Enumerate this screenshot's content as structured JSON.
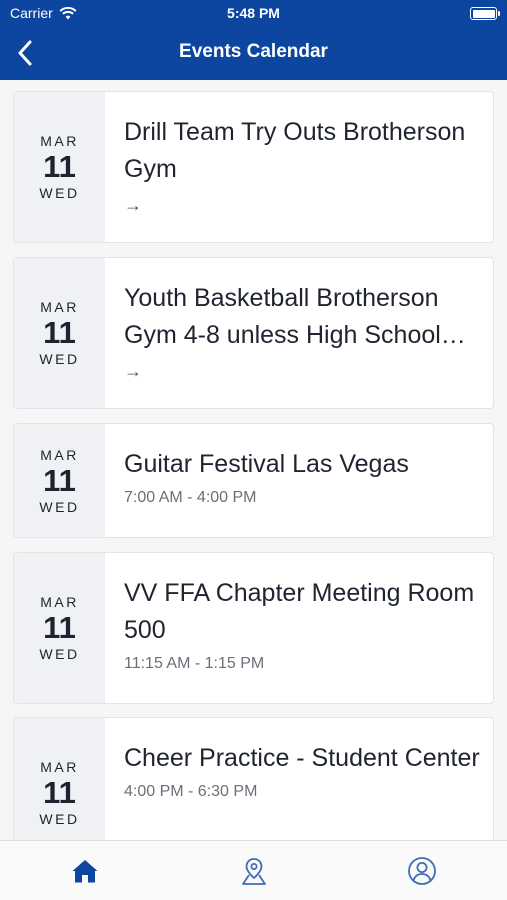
{
  "status_bar": {
    "carrier": "Carrier",
    "time": "5:48 PM"
  },
  "nav": {
    "title": "Events Calendar",
    "back_icon": "chevron-left-icon"
  },
  "events": [
    {
      "month": "MAR",
      "day": "11",
      "weekday": "WED",
      "title": "Drill Team Try Outs Brotherson Gym",
      "time": "",
      "arrow": "→"
    },
    {
      "month": "MAR",
      "day": "11",
      "weekday": "WED",
      "title": "Youth Basketball Brotherson Gym 4-8 unless High School…",
      "time": "",
      "arrow": "→"
    },
    {
      "month": "MAR",
      "day": "11",
      "weekday": "WED",
      "title": "Guitar Festival Las Vegas",
      "time": "7:00 AM - 4:00 PM",
      "arrow": ""
    },
    {
      "month": "MAR",
      "day": "11",
      "weekday": "WED",
      "title": "VV FFA Chapter Meeting Room 500",
      "time": "11:15 AM - 1:15 PM",
      "arrow": ""
    },
    {
      "month": "MAR",
      "day": "11",
      "weekday": "WED",
      "title": "Cheer Practice - Student Center",
      "time": "4:00 PM - 6:30 PM",
      "arrow": ""
    }
  ],
  "tabs": [
    {
      "icon": "home-icon",
      "active": true
    },
    {
      "icon": "map-pin-icon",
      "active": false
    },
    {
      "icon": "profile-icon",
      "active": false
    }
  ],
  "colors": {
    "primary": "#0d46a0",
    "date_bg": "#f0f1f4",
    "tab_active": "#0d46a0",
    "tab_inactive": "#3f6cb3"
  }
}
